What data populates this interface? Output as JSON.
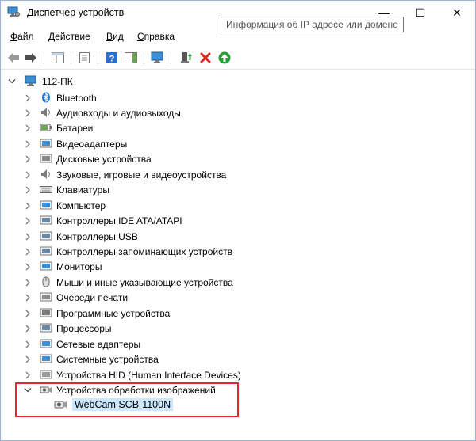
{
  "window": {
    "title": "Диспетчер устройств",
    "minimize_glyph": "—",
    "maximize_glyph": "☐",
    "close_glyph": "✕"
  },
  "menu": {
    "items": [
      {
        "label_ul": "Ф",
        "label_rest": "айл"
      },
      {
        "label_ul": "Д",
        "label_rest": "ействие"
      },
      {
        "label_ul": "В",
        "label_rest": "ид"
      },
      {
        "label_ul": "С",
        "label_rest": "правка"
      }
    ]
  },
  "tooltip": {
    "text": "Информация об IP адресе или домене"
  },
  "toolbar": {
    "icons": [
      "back-arrow-icon",
      "forward-arrow-icon",
      "show-hide-tree-icon",
      "properties-icon",
      "help-icon",
      "action-pane-icon",
      "monitor-scan-icon",
      "update-driver-icon",
      "uninstall-icon",
      "enable-device-icon"
    ],
    "colors": {
      "uninstall": "#d9261c",
      "enable": "#2a9d3a",
      "help": "#2a6fc9",
      "arrows": "#4f4f4f"
    }
  },
  "tree": {
    "root": {
      "label": "112-ПК",
      "expanded": true
    },
    "categories": [
      {
        "label": "Bluetooth",
        "icon": "bluetooth-icon"
      },
      {
        "label": "Аудиовходы и аудиовыходы",
        "icon": "audio-io-icon"
      },
      {
        "label": "Батареи",
        "icon": "battery-icon"
      },
      {
        "label": "Видеоадаптеры",
        "icon": "display-adapter-icon"
      },
      {
        "label": "Дисковые устройства",
        "icon": "disk-drive-icon"
      },
      {
        "label": "Звуковые, игровые и видеоустройства",
        "icon": "sound-icon"
      },
      {
        "label": "Клавиатуры",
        "icon": "keyboard-icon"
      },
      {
        "label": "Компьютер",
        "icon": "computer-icon"
      },
      {
        "label": "Контроллеры IDE ATA/ATAPI",
        "icon": "ide-controller-icon"
      },
      {
        "label": "Контроллеры USB",
        "icon": "usb-controller-icon"
      },
      {
        "label": "Контроллеры запоминающих устройств",
        "icon": "storage-controller-icon"
      },
      {
        "label": "Мониторы",
        "icon": "monitor-icon"
      },
      {
        "label": "Мыши и иные указывающие устройства",
        "icon": "mouse-icon"
      },
      {
        "label": "Очереди печати",
        "icon": "print-queue-icon"
      },
      {
        "label": "Программные устройства",
        "icon": "software-device-icon"
      },
      {
        "label": "Процессоры",
        "icon": "processor-icon"
      },
      {
        "label": "Сетевые адаптеры",
        "icon": "network-adapter-icon"
      },
      {
        "label": "Системные устройства",
        "icon": "system-device-icon"
      },
      {
        "label": "Устройства HID (Human Interface Devices)",
        "icon": "hid-icon"
      },
      {
        "label": "Устройства обработки изображений",
        "icon": "imaging-device-icon",
        "expanded": true
      }
    ],
    "child": {
      "label": "WebCam SCB-1100N",
      "icon": "webcam-icon"
    }
  },
  "highlight_color": "#e3262f"
}
